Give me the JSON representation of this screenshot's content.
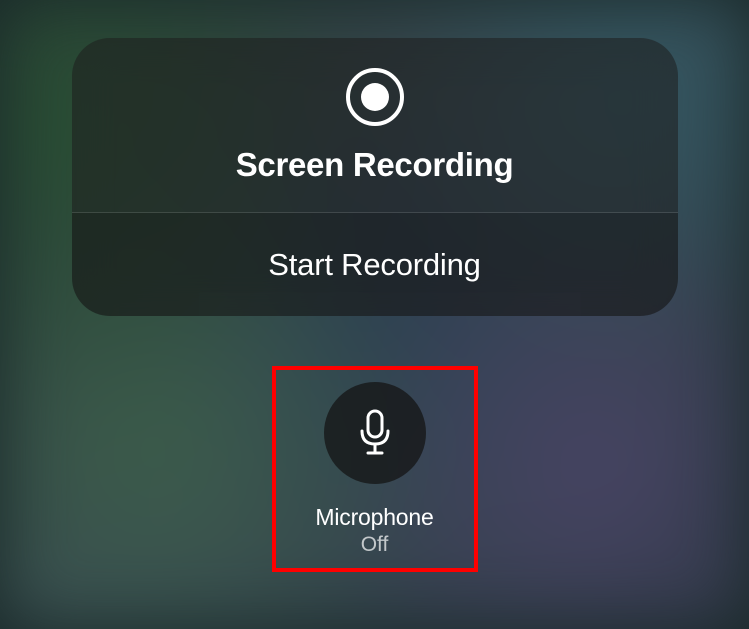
{
  "recording": {
    "title": "Screen Recording",
    "start_label": "Start Recording"
  },
  "microphone": {
    "label": "Microphone",
    "status": "Off"
  }
}
